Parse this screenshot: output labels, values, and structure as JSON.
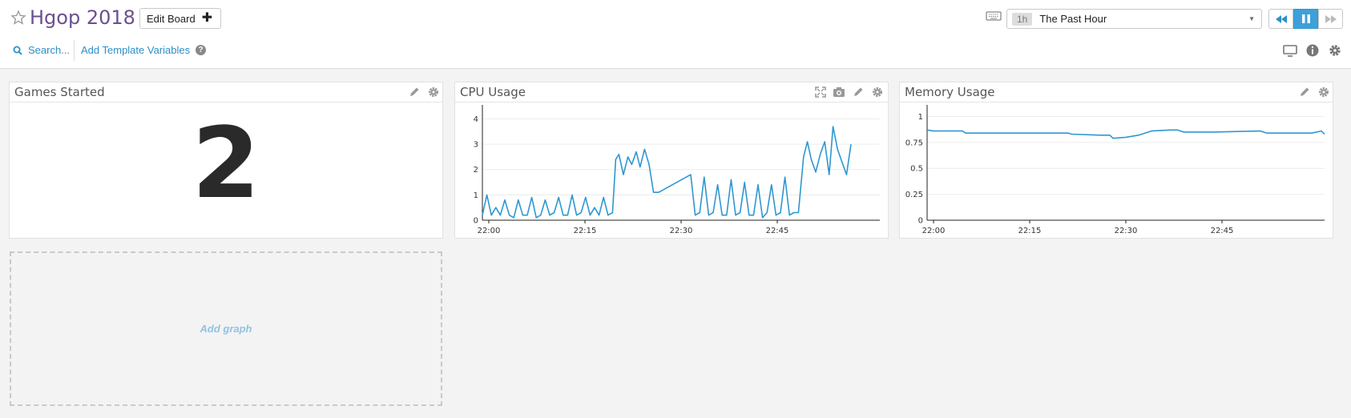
{
  "header": {
    "title": "Hgop 2018",
    "edit_board_label": "Edit Board",
    "search_label": "Search...",
    "template_vars_label": "Add Template Variables"
  },
  "time_selector": {
    "shortcut": "1h",
    "label": "The Past Hour"
  },
  "colors": {
    "accent": "#2c8fc7",
    "line": "#2f97d1",
    "title_purple": "#6c4f8f"
  },
  "icons": [
    "star-icon",
    "plus-icon",
    "search-icon",
    "help-icon",
    "keyboard-icon",
    "rewind-icon",
    "pause-icon",
    "forward-icon",
    "tv-icon",
    "info-icon",
    "gear-icon",
    "pencil-icon",
    "expand-icon",
    "camera-icon"
  ],
  "widgets": {
    "games": {
      "title": "Games Started",
      "value": "2"
    },
    "cpu": {
      "title": "CPU Usage"
    },
    "memory": {
      "title": "Memory Usage"
    }
  },
  "add_graph_label": "Add graph",
  "chart_data": [
    {
      "type": "line",
      "title": "CPU Usage",
      "x_ticks": [
        "22:00",
        "22:15",
        "22:30",
        "22:45"
      ],
      "x_unit": "minutes after 21:59",
      "ylim": [
        0,
        4.3
      ],
      "y_ticks": [
        "0",
        "1",
        "2",
        "3",
        "4"
      ],
      "series": [
        {
          "x": [
            0,
            0.7,
            1.4,
            2.1,
            2.8,
            3.5,
            4.2,
            4.9,
            5.6,
            6.3,
            7,
            7.7,
            8.4,
            9.1,
            9.8,
            10.5,
            11.2,
            11.9,
            12.6,
            13.3,
            14,
            14.7,
            15.4,
            16.1,
            16.8,
            17.5,
            18.2,
            18.9,
            19.6,
            20.3,
            20.8,
            21.3,
            22,
            22.7,
            23.3,
            24,
            24.6,
            25.3,
            26,
            26.7,
            27.5,
            32.5,
            33.2,
            33.9,
            34.6,
            35.3,
            36,
            36.7,
            37.4,
            38.1,
            38.8,
            39.5,
            40.2,
            40.9,
            41.6,
            42.3,
            43,
            43.7,
            44.4,
            45.1,
            45.8,
            46.5,
            47.2,
            47.9,
            48.6,
            49.3,
            50.1,
            50.7,
            51.3,
            52,
            52.7,
            53.4,
            54.1,
            54.7,
            55.4,
            56.1,
            56.8,
            57.5
          ],
          "y": [
            0.2,
            1.0,
            0.2,
            0.5,
            0.2,
            0.8,
            0.2,
            0.1,
            0.8,
            0.2,
            0.2,
            0.9,
            0.1,
            0.2,
            0.8,
            0.2,
            0.3,
            0.9,
            0.2,
            0.2,
            1.0,
            0.2,
            0.3,
            0.9,
            0.2,
            0.5,
            0.2,
            0.9,
            0.2,
            0.3,
            2.4,
            2.6,
            1.8,
            2.5,
            2.2,
            2.7,
            2.1,
            2.8,
            2.2,
            1.1,
            1.1,
            1.8,
            0.2,
            0.3,
            1.7,
            0.2,
            0.3,
            1.4,
            0.2,
            0.2,
            1.6,
            0.2,
            0.3,
            1.5,
            0.2,
            0.2,
            1.4,
            0.1,
            0.3,
            1.4,
            0.2,
            0.3,
            1.7,
            0.2,
            0.3,
            0.3,
            2.5,
            3.1,
            2.4,
            1.9,
            2.6,
            3.1,
            1.8,
            3.7,
            2.8,
            2.3,
            1.8,
            3.0
          ]
        }
      ]
    },
    {
      "type": "line",
      "title": "Memory Usage",
      "x_ticks": [
        "22:00",
        "22:15",
        "22:30",
        "22:45"
      ],
      "x_unit": "minutes after 21:59",
      "ylim": [
        0,
        1.05
      ],
      "y_ticks": [
        "0",
        "0.25",
        "0.5",
        "0.75",
        "1"
      ],
      "series": [
        {
          "x": [
            0,
            1,
            2,
            4,
            5.5,
            6,
            8,
            12,
            20,
            22,
            22.5,
            27,
            28.5,
            29,
            31,
            33,
            33.5,
            35,
            38,
            39,
            40,
            45,
            52,
            53,
            55,
            58,
            60,
            61.5,
            62
          ],
          "y": [
            0.87,
            0.86,
            0.86,
            0.86,
            0.86,
            0.84,
            0.84,
            0.84,
            0.84,
            0.84,
            0.83,
            0.82,
            0.82,
            0.79,
            0.8,
            0.82,
            0.83,
            0.86,
            0.87,
            0.87,
            0.85,
            0.85,
            0.86,
            0.84,
            0.84,
            0.84,
            0.84,
            0.86,
            0.83
          ]
        }
      ]
    }
  ]
}
